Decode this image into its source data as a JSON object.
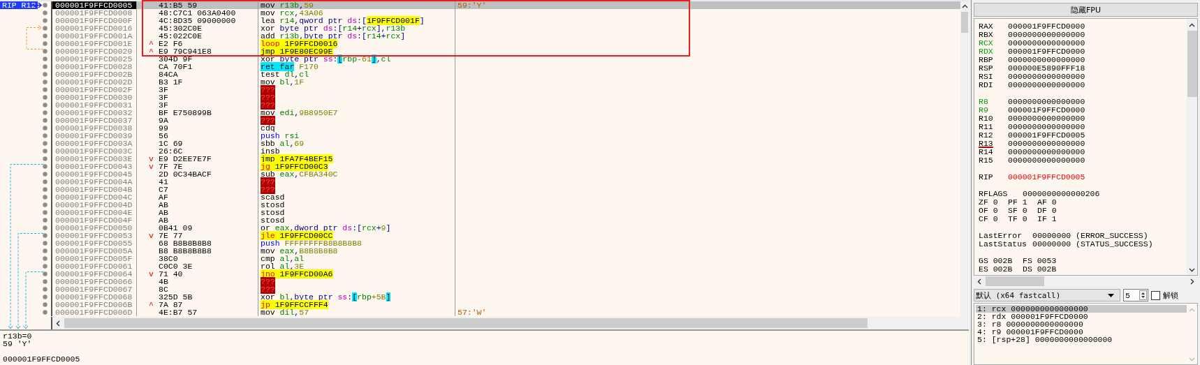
{
  "disassembly": {
    "rows": [
      {
        "address": "000001F9FFCD0005",
        "bytes": "41:B5 59",
        "instruction": [
          {
            "text": "mov ",
            "kind": "op"
          },
          {
            "text": "r13b",
            "kind": "reg"
          },
          {
            "text": ",",
            "kind": "text"
          },
          {
            "text": "59",
            "kind": "imm"
          }
        ],
        "comment": "59:'Y'",
        "selected": true,
        "label": "RIP R12"
      },
      {
        "address": "000001F9FFCD0008",
        "bytes": "48:C7C1 063A0400",
        "instruction": [
          {
            "text": "mov ",
            "kind": "op"
          },
          {
            "text": "rcx",
            "kind": "reg"
          },
          {
            "text": ",",
            "kind": "text"
          },
          {
            "text": "43A06",
            "kind": "imm"
          }
        ],
        "selected": false
      },
      {
        "address": "000001F9FFCD000F",
        "bytes": "4C:8D35 09000000",
        "instruction": [
          {
            "text": "lea ",
            "kind": "op"
          },
          {
            "text": "r14",
            "kind": "reg"
          },
          {
            "text": ",",
            "kind": "text"
          },
          {
            "text": "qword ptr ",
            "kind": "size"
          },
          {
            "text": "ds",
            "kind": "seg"
          },
          {
            "text": ":[",
            "kind": "text"
          },
          {
            "text": "1F9FFCD001F",
            "kind": "target"
          },
          {
            "text": "]",
            "kind": "text"
          }
        ],
        "selected": false
      },
      {
        "address": "000001F9FFCD0016",
        "bytes": "45:302C0E",
        "instruction": [
          {
            "text": "xor ",
            "kind": "op"
          },
          {
            "text": "byte ptr ",
            "kind": "size"
          },
          {
            "text": "ds",
            "kind": "seg"
          },
          {
            "text": ":[",
            "kind": "text"
          },
          {
            "text": "r14",
            "kind": "reg"
          },
          {
            "text": "+",
            "kind": "text"
          },
          {
            "text": "rcx",
            "kind": "reg"
          },
          {
            "text": "],",
            "kind": "text"
          },
          {
            "text": "r13b",
            "kind": "reg"
          }
        ],
        "selected": false
      },
      {
        "address": "000001F9FFCD001A",
        "bytes": "45:022C0E",
        "instruction": [
          {
            "text": "add ",
            "kind": "op"
          },
          {
            "text": "r13b",
            "kind": "reg"
          },
          {
            "text": ",",
            "kind": "text"
          },
          {
            "text": "byte ptr ",
            "kind": "size"
          },
          {
            "text": "ds",
            "kind": "seg"
          },
          {
            "text": ":[",
            "kind": "text"
          },
          {
            "text": "r14",
            "kind": "reg"
          },
          {
            "text": "+",
            "kind": "text"
          },
          {
            "text": "rcx",
            "kind": "reg"
          },
          {
            "text": "]",
            "kind": "text"
          }
        ],
        "selected": false
      },
      {
        "address": "000001F9FFCD001E",
        "mark": "^",
        "bytes": "E2 F6",
        "instruction": [
          {
            "text": "loop ",
            "kind": "cond"
          },
          {
            "text": "1F9FFCD0016",
            "kind": "target"
          }
        ],
        "selected": false
      },
      {
        "address": "000001F9FFCD0020",
        "mark": "^",
        "bytes": "E9 79C941E8",
        "instruction": [
          {
            "text": "jmp ",
            "kind": "jump"
          },
          {
            "text": "1F9E80EC99E",
            "kind": "target"
          }
        ],
        "selected": false
      },
      {
        "address": "000001F9FFCD0025",
        "bytes": "304D 9F",
        "instruction": [
          {
            "text": "xor ",
            "kind": "op"
          },
          {
            "text": "byte ptr ",
            "kind": "size"
          },
          {
            "text": "ss",
            "kind": "seg"
          },
          {
            "text": ":",
            "kind": "text"
          },
          {
            "text": "[",
            "kind": "bracket"
          },
          {
            "text": "rbp",
            "kind": "reg"
          },
          {
            "text": "-61",
            "kind": "imm"
          },
          {
            "text": "]",
            "kind": "bracket"
          },
          {
            "text": ",",
            "kind": "text"
          },
          {
            "text": "cl",
            "kind": "reg"
          }
        ],
        "selected": false
      },
      {
        "address": "000001F9FFCD0028",
        "bytes": "CA 70F1",
        "instruction": [
          {
            "text": "ret far",
            "kind": "ret"
          },
          {
            "text": " F170",
            "kind": "imm"
          }
        ],
        "selected": false
      },
      {
        "address": "000001F9FFCD002B",
        "bytes": "84CA",
        "instruction": [
          {
            "text": "test ",
            "kind": "op"
          },
          {
            "text": "dl",
            "kind": "reg"
          },
          {
            "text": ",",
            "kind": "text"
          },
          {
            "text": "cl",
            "kind": "reg"
          }
        ],
        "selected": false
      },
      {
        "address": "000001F9FFCD002D",
        "bytes": "B3 1F",
        "instruction": [
          {
            "text": "mov ",
            "kind": "op"
          },
          {
            "text": "bl",
            "kind": "reg"
          },
          {
            "text": ",",
            "kind": "text"
          },
          {
            "text": "1F",
            "kind": "imm"
          }
        ],
        "selected": false
      },
      {
        "address": "000001F9FFCD002F",
        "bytes": "3F",
        "instruction": [
          {
            "text": "???",
            "kind": "bad"
          }
        ],
        "selected": false
      },
      {
        "address": "000001F9FFCD0030",
        "bytes": "3F",
        "instruction": [
          {
            "text": "???",
            "kind": "bad"
          }
        ],
        "selected": false
      },
      {
        "address": "000001F9FFCD0031",
        "bytes": "3F",
        "instruction": [
          {
            "text": "???",
            "kind": "bad"
          }
        ],
        "selected": false
      },
      {
        "address": "000001F9FFCD0032",
        "bytes": "BF E750899B",
        "instruction": [
          {
            "text": "mov ",
            "kind": "op"
          },
          {
            "text": "edi",
            "kind": "reg"
          },
          {
            "text": ",",
            "kind": "text"
          },
          {
            "text": "9B8950E7",
            "kind": "imm"
          }
        ],
        "selected": false
      },
      {
        "address": "000001F9FFCD0037",
        "bytes": "9A",
        "instruction": [
          {
            "text": "???",
            "kind": "bad"
          }
        ],
        "selected": false
      },
      {
        "address": "000001F9FFCD0038",
        "bytes": "99",
        "instruction": [
          {
            "text": "cdq",
            "kind": "op"
          }
        ],
        "selected": false
      },
      {
        "address": "000001F9FFCD0039",
        "bytes": "56",
        "instruction": [
          {
            "text": "push ",
            "kind": "stack"
          },
          {
            "text": "rsi",
            "kind": "reg"
          }
        ],
        "selected": false
      },
      {
        "address": "000001F9FFCD003A",
        "bytes": "1C 69",
        "instruction": [
          {
            "text": "sbb ",
            "kind": "op"
          },
          {
            "text": "al",
            "kind": "reg"
          },
          {
            "text": ",",
            "kind": "text"
          },
          {
            "text": "69",
            "kind": "imm"
          }
        ],
        "selected": false
      },
      {
        "address": "000001F9FFCD003C",
        "bytes": "26:6C",
        "instruction": [
          {
            "text": "insb",
            "kind": "op"
          }
        ],
        "selected": false
      },
      {
        "address": "000001F9FFCD003E",
        "mark": "v",
        "bytes": "E9 D2EE7E7F",
        "instruction": [
          {
            "text": "jmp ",
            "kind": "jump"
          },
          {
            "text": "1FA7F4BEF15",
            "kind": "target"
          }
        ],
        "selected": false
      },
      {
        "address": "000001F9FFCD0043",
        "mark": "v",
        "bytes": "7F 7E",
        "instruction": [
          {
            "text": "jg ",
            "kind": "cond"
          },
          {
            "text": "1F9FFCD00C3",
            "kind": "target"
          }
        ],
        "selected": false
      },
      {
        "address": "000001F9FFCD0045",
        "bytes": "2D 0C34BACF",
        "instruction": [
          {
            "text": "sub ",
            "kind": "op"
          },
          {
            "text": "eax",
            "kind": "reg"
          },
          {
            "text": ",",
            "kind": "text"
          },
          {
            "text": "CFBA340C",
            "kind": "imm"
          }
        ],
        "selected": false
      },
      {
        "address": "000001F9FFCD004A",
        "bytes": "41",
        "instruction": [
          {
            "text": "???",
            "kind": "bad"
          }
        ],
        "selected": false
      },
      {
        "address": "000001F9FFCD004B",
        "bytes": "C7",
        "instruction": [
          {
            "text": "???",
            "kind": "bad"
          }
        ],
        "selected": false
      },
      {
        "address": "000001F9FFCD004C",
        "bytes": "AF",
        "instruction": [
          {
            "text": "scasd",
            "kind": "op"
          }
        ],
        "selected": false
      },
      {
        "address": "000001F9FFCD004D",
        "bytes": "AB",
        "instruction": [
          {
            "text": "stosd",
            "kind": "op"
          }
        ],
        "selected": false
      },
      {
        "address": "000001F9FFCD004E",
        "bytes": "AB",
        "instruction": [
          {
            "text": "stosd",
            "kind": "op"
          }
        ],
        "selected": false
      },
      {
        "address": "000001F9FFCD004F",
        "bytes": "AB",
        "instruction": [
          {
            "text": "stosd",
            "kind": "op"
          }
        ],
        "selected": false
      },
      {
        "address": "000001F9FFCD0050",
        "bytes": "0B41 09",
        "instruction": [
          {
            "text": "or ",
            "kind": "op"
          },
          {
            "text": "eax",
            "kind": "reg"
          },
          {
            "text": ",",
            "kind": "text"
          },
          {
            "text": "dword ptr ",
            "kind": "size"
          },
          {
            "text": "ds",
            "kind": "seg"
          },
          {
            "text": ":[",
            "kind": "text"
          },
          {
            "text": "rcx",
            "kind": "reg"
          },
          {
            "text": "+",
            "kind": "text"
          },
          {
            "text": "9",
            "kind": "imm"
          },
          {
            "text": "]",
            "kind": "text"
          }
        ],
        "selected": false
      },
      {
        "address": "000001F9FFCD0053",
        "mark": "v",
        "bytes": "7E 77",
        "instruction": [
          {
            "text": "jle ",
            "kind": "cond"
          },
          {
            "text": "1F9FFCD00CC",
            "kind": "target"
          }
        ],
        "selected": false
      },
      {
        "address": "000001F9FFCD0055",
        "bytes": "68 B8B8B8B8",
        "instruction": [
          {
            "text": "push ",
            "kind": "stack"
          },
          {
            "text": "FFFFFFFFB8B8B8B8",
            "kind": "imm"
          }
        ],
        "selected": false
      },
      {
        "address": "000001F9FFCD005A",
        "bytes": "B8 B8B8B8B8",
        "instruction": [
          {
            "text": "mov ",
            "kind": "op"
          },
          {
            "text": "eax",
            "kind": "reg"
          },
          {
            "text": ",",
            "kind": "text"
          },
          {
            "text": "B8B8B8B8",
            "kind": "imm"
          }
        ],
        "selected": false
      },
      {
        "address": "000001F9FFCD005F",
        "bytes": "38C0",
        "instruction": [
          {
            "text": "cmp ",
            "kind": "op"
          },
          {
            "text": "al",
            "kind": "reg"
          },
          {
            "text": ",",
            "kind": "text"
          },
          {
            "text": "al",
            "kind": "reg"
          }
        ],
        "selected": false
      },
      {
        "address": "000001F9FFCD0061",
        "bytes": "C0C0 3E",
        "instruction": [
          {
            "text": "rol ",
            "kind": "op"
          },
          {
            "text": "al",
            "kind": "reg"
          },
          {
            "text": ",",
            "kind": "text"
          },
          {
            "text": "3E",
            "kind": "imm"
          }
        ],
        "selected": false
      },
      {
        "address": "000001F9FFCD0064",
        "mark": "v",
        "bytes": "71 40",
        "instruction": [
          {
            "text": "jno ",
            "kind": "cond"
          },
          {
            "text": "1F9FFCD00A6",
            "kind": "target"
          }
        ],
        "selected": false
      },
      {
        "address": "000001F9FFCD0066",
        "bytes": "4B",
        "instruction": [
          {
            "text": "???",
            "kind": "bad"
          }
        ],
        "selected": false
      },
      {
        "address": "000001F9FFCD0067",
        "bytes": "8C",
        "instruction": [
          {
            "text": "???",
            "kind": "bad"
          }
        ],
        "selected": false
      },
      {
        "address": "000001F9FFCD0068",
        "bytes": "325D 5B",
        "instruction": [
          {
            "text": "xor ",
            "kind": "op"
          },
          {
            "text": "bl",
            "kind": "reg"
          },
          {
            "text": ",",
            "kind": "text"
          },
          {
            "text": "byte ptr ",
            "kind": "size"
          },
          {
            "text": "ss",
            "kind": "seg"
          },
          {
            "text": ":",
            "kind": "text"
          },
          {
            "text": "[",
            "kind": "bracket"
          },
          {
            "text": "rbp",
            "kind": "reg"
          },
          {
            "text": "+5B",
            "kind": "imm"
          },
          {
            "text": "]",
            "kind": "bracket"
          }
        ],
        "selected": false
      },
      {
        "address": "000001F9FFCD006B",
        "mark": "^",
        "bytes": "7A 87",
        "instruction": [
          {
            "text": "jp ",
            "kind": "cond"
          },
          {
            "text": "1F9FFCCFFF4",
            "kind": "target"
          }
        ],
        "selected": false
      },
      {
        "address": "000001F9FFCD006D",
        "bytes": "4E:B7 57",
        "instruction": [
          {
            "text": "mov ",
            "kind": "op"
          },
          {
            "text": "dil",
            "kind": "reg"
          },
          {
            "text": ",",
            "kind": "text"
          },
          {
            "text": "57",
            "kind": "imm"
          }
        ],
        "comment": "57:'W'",
        "selected": false
      }
    ]
  },
  "info": {
    "lines": [
      "r13b=0",
      "59 'Y'"
    ],
    "address": "000001F9FFCD0005"
  },
  "registers": {
    "toggle_button": "隐藏FPU",
    "groups": [
      [
        {
          "name": "RAX",
          "value": "000001F9FFCD0000",
          "kind": "plain"
        },
        {
          "name": "RBX",
          "value": "0000000000000000",
          "kind": "plain"
        },
        {
          "name": "RCX",
          "value": "0000000000000000",
          "kind": "modified"
        },
        {
          "name": "RDX",
          "value": "000001F9FFCD0000",
          "kind": "modified"
        },
        {
          "name": "RBP",
          "value": "0000000000000000",
          "kind": "plain"
        },
        {
          "name": "RSP",
          "value": "000000E5890FFF18",
          "kind": "plain"
        },
        {
          "name": "RSI",
          "value": "0000000000000000",
          "kind": "plain"
        },
        {
          "name": "RDI",
          "value": "0000000000000000",
          "kind": "plain"
        }
      ],
      [
        {
          "name": "R8",
          "value": "0000000000000000",
          "kind": "modified"
        },
        {
          "name": "R9",
          "value": "000001F9FFCD0000",
          "kind": "modified"
        },
        {
          "name": "R10",
          "value": "0000000000000000",
          "kind": "plain"
        },
        {
          "name": "R11",
          "value": "0000000000000000",
          "kind": "plain"
        },
        {
          "name": "R12",
          "value": "000001F9FFCD0005",
          "kind": "plain"
        },
        {
          "name": "R13",
          "value": "0000000000000000",
          "kind": "underlined"
        },
        {
          "name": "R14",
          "value": "0000000000000000",
          "kind": "plain"
        },
        {
          "name": "R15",
          "value": "0000000000000000",
          "kind": "plain"
        }
      ],
      [
        {
          "name": "RIP",
          "value": "000001F9FFCD0005",
          "kind": "pointer"
        }
      ]
    ],
    "rflags": {
      "name": "RFLAGS",
      "value": "0000000000000206"
    },
    "flags": [
      [
        {
          "name": "ZF",
          "value": "0"
        },
        {
          "name": "PF",
          "value": "1"
        },
        {
          "name": "AF",
          "value": "0"
        }
      ],
      [
        {
          "name": "OF",
          "value": "0"
        },
        {
          "name": "SF",
          "value": "0"
        },
        {
          "name": "DF",
          "value": "0"
        }
      ],
      [
        {
          "name": "CF",
          "value": "0"
        },
        {
          "name": "TF",
          "value": "0"
        },
        {
          "name": "IF",
          "value": "1"
        }
      ]
    ],
    "status": [
      {
        "name": "LastError",
        "value": "00000000 (ERROR_SUCCESS)"
      },
      {
        "name": "LastStatus",
        "value": "00000000 (STATUS_SUCCESS)"
      }
    ],
    "segments": [
      [
        {
          "name": "GS",
          "value": "002B"
        },
        {
          "name": "FS",
          "value": "0053"
        }
      ],
      [
        {
          "name": "ES",
          "value": "002B"
        },
        {
          "name": "DS",
          "value": "002B"
        }
      ]
    ]
  },
  "call_stack": {
    "convention": "默认 (x64 fastcall)",
    "count": "5",
    "unlock": {
      "label": "解锁",
      "checked": false
    },
    "args": [
      {
        "text": "1: rcx 0000000000000000",
        "selected": true
      },
      {
        "text": "2: rdx 000001F9FFCD0000",
        "selected": false
      },
      {
        "text": "3: r8 0000000000000000",
        "selected": false
      },
      {
        "text": "4: r9 000001F9FFCD0000",
        "selected": false
      },
      {
        "text": "5: [rsp+28] 0000000000000000",
        "selected": false
      }
    ]
  }
}
